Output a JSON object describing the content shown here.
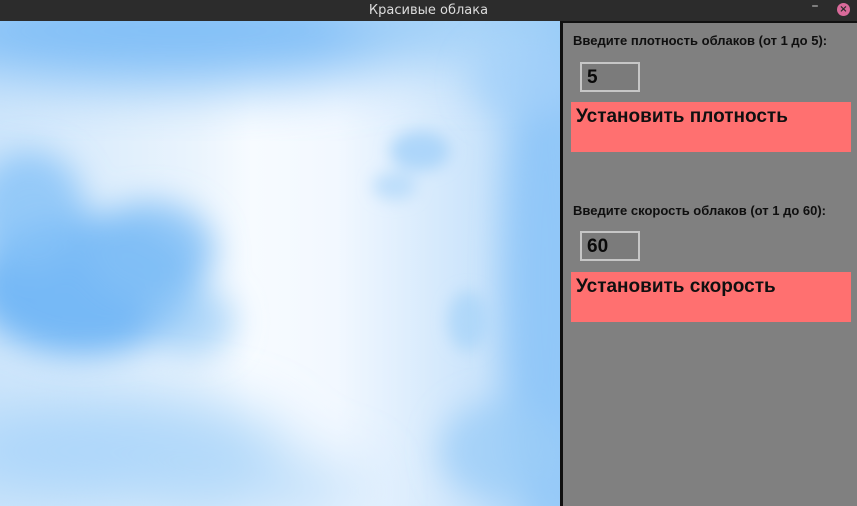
{
  "window": {
    "title": "Красивые облака",
    "minimize_glyph": "–",
    "close_glyph": "×"
  },
  "density": {
    "prompt": "Введите плотность облаков (от 1 до 5):",
    "value": "5",
    "button_label": "Установить плотность"
  },
  "speed": {
    "prompt": "Введите скорость облаков (от 1 до 60):",
    "value": "60",
    "button_label": "Установить скорость"
  },
  "colors": {
    "panel_bg": "#808080",
    "button_bg": "#ff7070",
    "sky_deep": "#7dbdf7",
    "sky_light": "#f7fbff",
    "close_button": "#d96a9a"
  }
}
